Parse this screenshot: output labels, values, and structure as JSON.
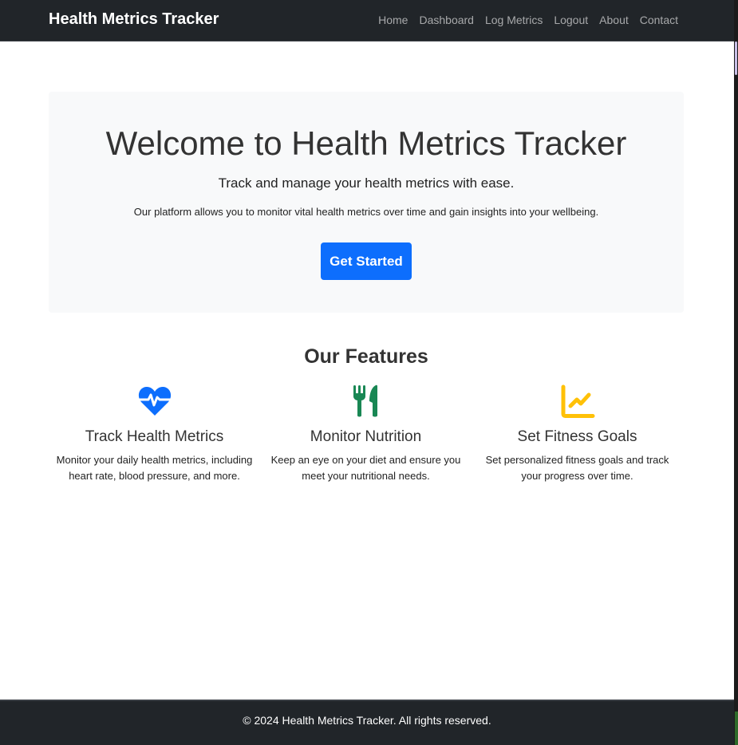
{
  "navbar": {
    "brand": "Health Metrics Tracker",
    "links": [
      "Home",
      "Dashboard",
      "Log Metrics",
      "Logout",
      "About",
      "Contact"
    ]
  },
  "hero": {
    "title": "Welcome to Health Metrics Tracker",
    "lead": "Track and manage your health metrics with ease.",
    "description": "Our platform allows you to monitor vital health metrics over time and gain insights into your wellbeing.",
    "cta_label": "Get Started"
  },
  "features": {
    "title": "Our Features",
    "items": [
      {
        "icon": "heart-pulse-icon",
        "icon_color": "#0d6efd",
        "title": "Track Health Metrics",
        "text": "Monitor your daily health metrics, including heart rate, blood pressure, and more."
      },
      {
        "icon": "utensils-icon",
        "icon_color": "#198754",
        "title": "Monitor Nutrition",
        "text": "Keep an eye on your diet and ensure you meet your nutritional needs."
      },
      {
        "icon": "chart-line-icon",
        "icon_color": "#ffc107",
        "title": "Set Fitness Goals",
        "text": "Set personalized fitness goals and track your progress over time."
      }
    ]
  },
  "footer": {
    "text": "© 2024 Health Metrics Tracker. All rights reserved."
  },
  "colors": {
    "navbar_bg": "#212529",
    "primary": "#0d6efd",
    "hero_bg": "#f8f9fa"
  }
}
